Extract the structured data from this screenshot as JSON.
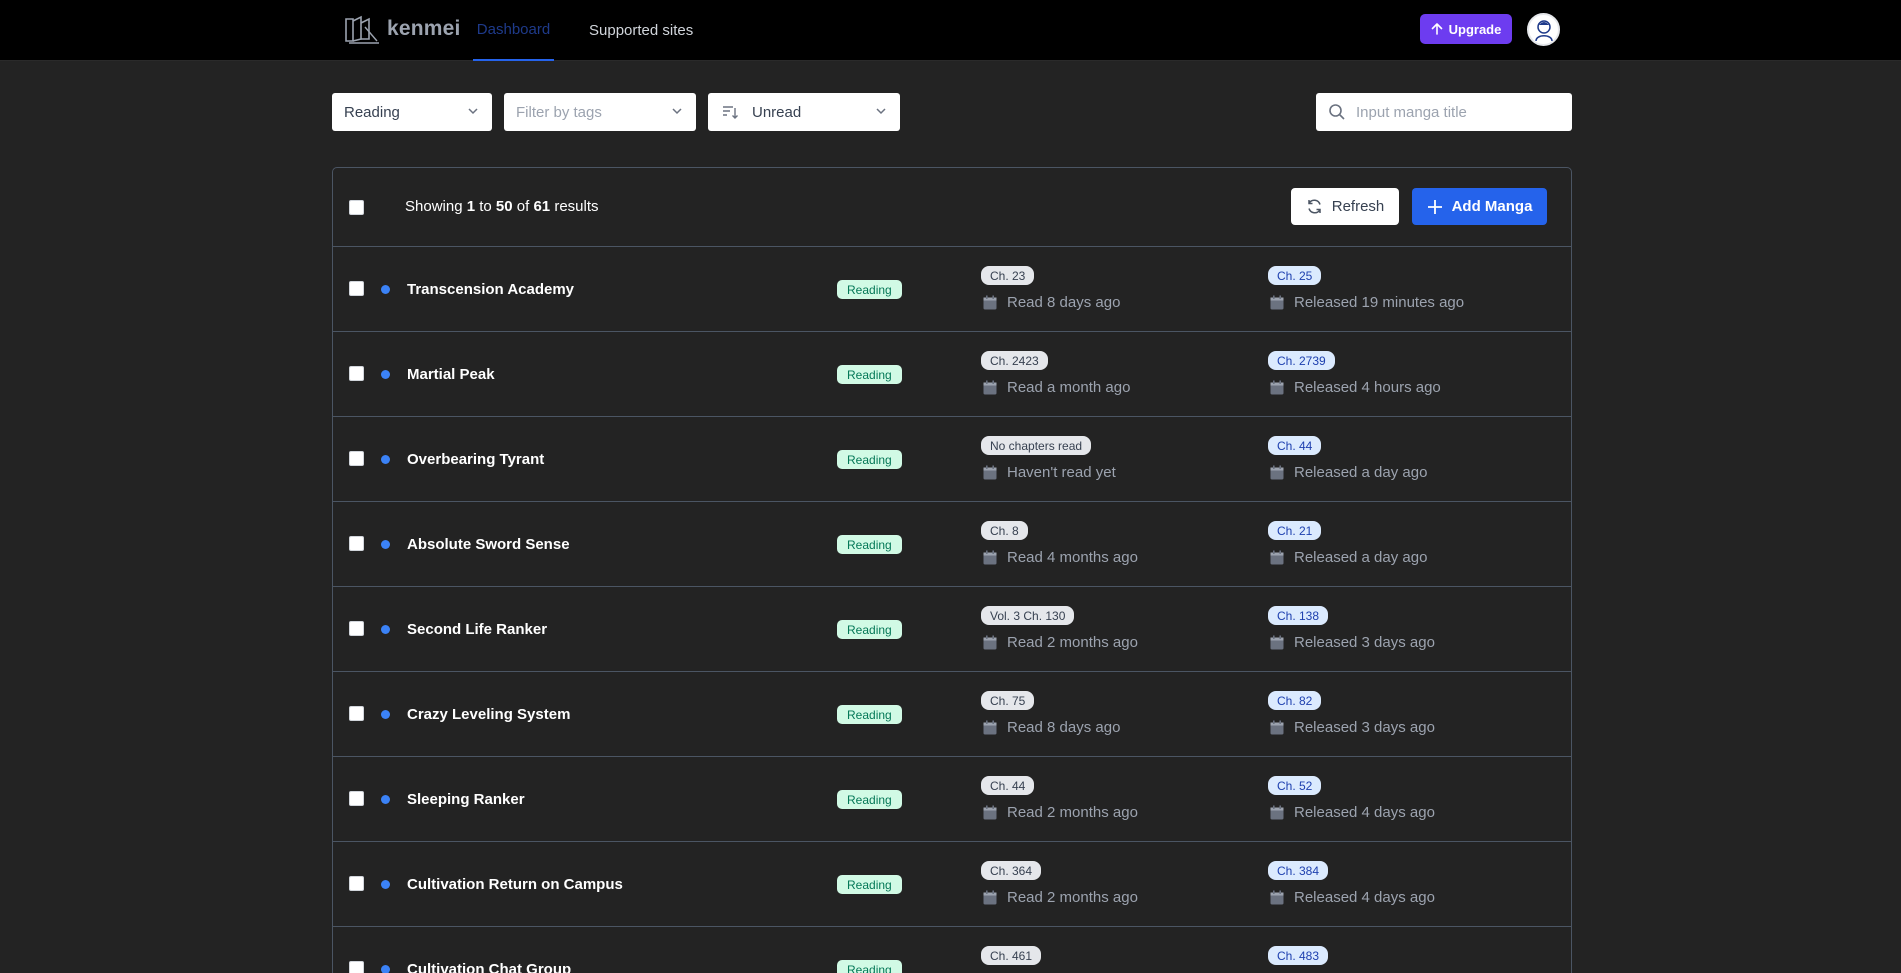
{
  "nav": {
    "brand": "kenmei",
    "tabs": [
      {
        "label": "Dashboard",
        "active": true
      },
      {
        "label": "Supported sites",
        "active": false
      }
    ],
    "upgrade_label": "Upgrade"
  },
  "filters": {
    "status_value": "Reading",
    "tags_placeholder": "Filter by tags",
    "sort_value": "Unread",
    "search_placeholder": "Input manga title"
  },
  "table": {
    "showing": {
      "prefix": "Showing",
      "from": "1",
      "to_word": "to",
      "to": "50",
      "of_word": "of",
      "total": "61",
      "suffix": "results"
    },
    "refresh_label": "Refresh",
    "add_label": "Add Manga",
    "rows": [
      {
        "title": "Transcension Academy",
        "status": "Reading",
        "read_ch": "Ch. 23",
        "read_time": "Read 8 days ago",
        "latest_ch": "Ch. 25",
        "released": "Released 19 minutes ago"
      },
      {
        "title": "Martial Peak",
        "status": "Reading",
        "read_ch": "Ch. 2423",
        "read_time": "Read a month ago",
        "latest_ch": "Ch. 2739",
        "released": "Released 4 hours ago"
      },
      {
        "title": "Overbearing Tyrant",
        "status": "Reading",
        "read_ch": "No chapters read",
        "read_time": "Haven't read yet",
        "latest_ch": "Ch. 44",
        "released": "Released a day ago"
      },
      {
        "title": "Absolute Sword Sense",
        "status": "Reading",
        "read_ch": "Ch. 8",
        "read_time": "Read 4 months ago",
        "latest_ch": "Ch. 21",
        "released": "Released a day ago"
      },
      {
        "title": "Second Life Ranker",
        "status": "Reading",
        "read_ch": "Vol. 3 Ch. 130",
        "read_time": "Read 2 months ago",
        "latest_ch": "Ch. 138",
        "released": "Released 3 days ago"
      },
      {
        "title": "Crazy Leveling System",
        "status": "Reading",
        "read_ch": "Ch. 75",
        "read_time": "Read 8 days ago",
        "latest_ch": "Ch. 82",
        "released": "Released 3 days ago"
      },
      {
        "title": "Sleeping Ranker",
        "status": "Reading",
        "read_ch": "Ch. 44",
        "read_time": "Read 2 months ago",
        "latest_ch": "Ch. 52",
        "released": "Released 4 days ago"
      },
      {
        "title": "Cultivation Return on Campus",
        "status": "Reading",
        "read_ch": "Ch. 364",
        "read_time": "Read 2 months ago",
        "latest_ch": "Ch. 384",
        "released": "Released 4 days ago"
      },
      {
        "title": "Cultivation Chat Group",
        "status": "Reading",
        "read_ch": "Ch. 461",
        "read_time": "",
        "latest_ch": "Ch. 483",
        "released": ""
      }
    ]
  },
  "colors": {
    "background": "#232323",
    "topbar": "#000000",
    "accent": "#2563eb",
    "upgrade": "#6d3cf0",
    "status_badge_bg": "#d1fae5",
    "status_badge_fg": "#047857"
  }
}
